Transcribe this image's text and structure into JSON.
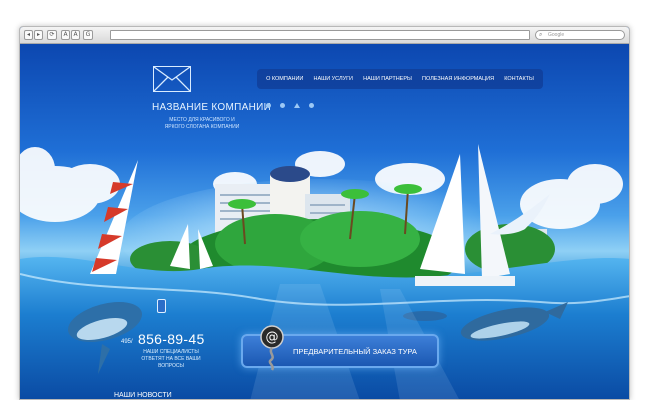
{
  "browser": {
    "nav_back": "◂",
    "nav_forward": "▸",
    "reload": "⟳",
    "font_small": "A",
    "font_large": "A",
    "google_g": "G",
    "search_placeholder": "Google"
  },
  "site": {
    "company_name": "НАЗВАНИЕ КОМПАНИИ",
    "slogan": "МЕСТО ДЛЯ КРАСИВОГО И ЯРКОГО СЛОГАНА КОМПАНИИ",
    "logo_icon": "envelope-icon"
  },
  "menu": {
    "items": [
      {
        "label": "О КОМПАНИИ"
      },
      {
        "label": "НАШИ УСЛУГИ"
      },
      {
        "label": "НАШИ ПАРТНЕРЫ"
      },
      {
        "label": "ПОЛЕЗНАЯ ИНФОРМАЦИЯ"
      },
      {
        "label": "КОНТАКТЫ"
      }
    ]
  },
  "contact": {
    "phone_code": "495/",
    "phone_number": "856-89-45",
    "note": "НАШИ СПЕЦИАЛИСТЫ ОТВЕТЯТ НА ВСЕ ВАШИ ВОПРОСЫ"
  },
  "cta": {
    "label": "ПРЕДВАРИТЕЛЬНЫЙ ЗАКАЗ ТУРА",
    "icon": "at-sign-icon"
  },
  "news": {
    "title": "НАШИ НОВОСТИ"
  },
  "colors": {
    "sky_top": "#0c47b0",
    "water": "#1270c4",
    "island_green": "#2e9a3a",
    "menu_bg": "#103c96"
  }
}
